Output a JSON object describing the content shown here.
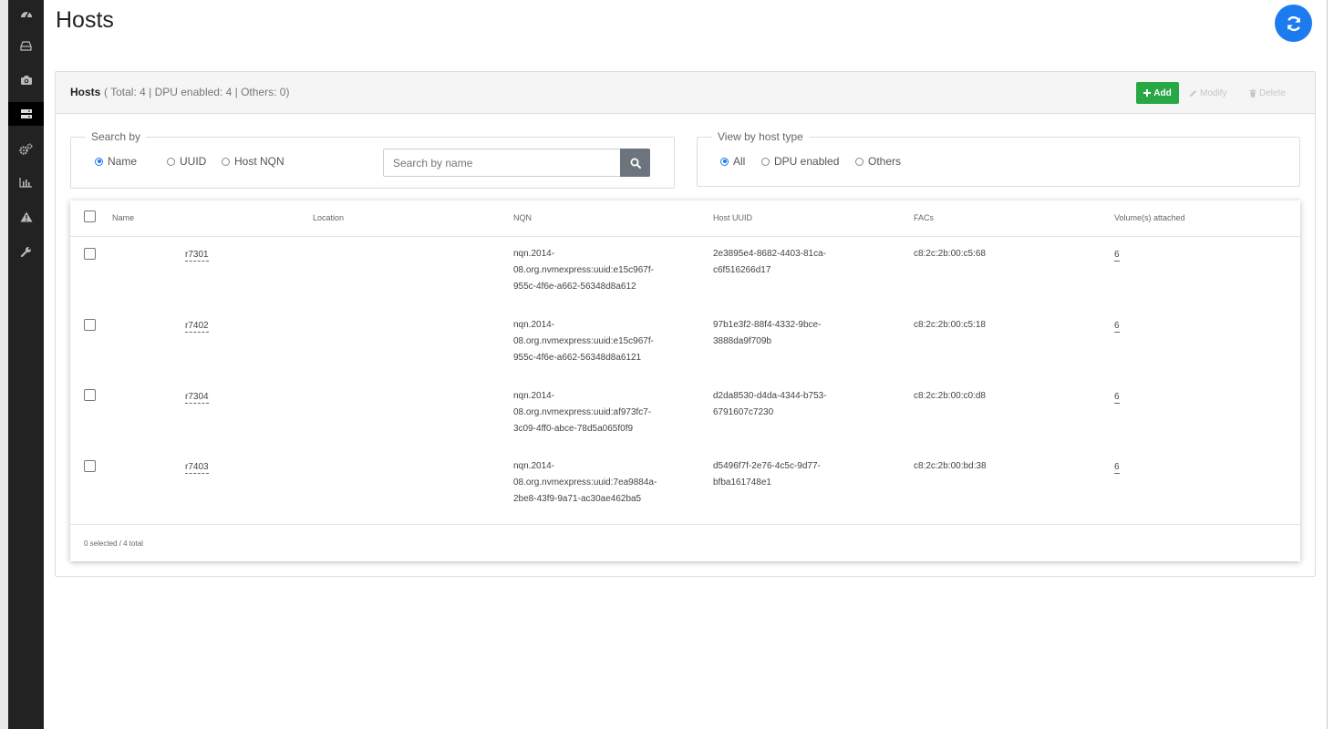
{
  "sidebar": {
    "items": [
      {
        "icon": "dashboard-icon",
        "active": false
      },
      {
        "icon": "drive-icon",
        "active": false
      },
      {
        "icon": "camera-icon",
        "active": false
      },
      {
        "icon": "server-icon",
        "active": true
      },
      {
        "icon": "gears-icon",
        "active": false
      },
      {
        "icon": "bar-chart-icon",
        "active": false
      },
      {
        "icon": "warning-icon",
        "active": false
      },
      {
        "icon": "wrench-icon",
        "active": false
      }
    ]
  },
  "page": {
    "title": "Hosts",
    "refresh_icon": "refresh-icon"
  },
  "panel": {
    "title": "Hosts",
    "summary": "( Total: 4 | DPU enabled: 4 | Others: 0)",
    "add_label": "Add",
    "modify_label": "Modify",
    "delete_label": "Delete"
  },
  "search": {
    "legend": "Search by",
    "options": [
      "Name",
      "UUID",
      "Host NQN"
    ],
    "selected": "Name",
    "placeholder": "Search by name",
    "value": ""
  },
  "filter": {
    "legend": "View by host type",
    "options": [
      "All",
      "DPU enabled",
      "Others"
    ],
    "selected": "All"
  },
  "table": {
    "columns": [
      "Name",
      "Location",
      "NQN",
      "Host UUID",
      "FACs",
      "Volume(s) attached"
    ],
    "rows": [
      {
        "name": "r7301",
        "location": "",
        "nqn": [
          "nqn.2014-",
          "08.org.nvmexpress:uuid:e15c967f-",
          "955c-4f6e-a662-56348d8a612"
        ],
        "uuid": [
          "2e3895e4-8682-4403-81ca-",
          "c6f516266d17"
        ],
        "facs": "c8:2c:2b:00:c5:68",
        "volumes": "6"
      },
      {
        "name": "r7402",
        "location": "",
        "nqn": [
          "nqn.2014-",
          "08.org.nvmexpress:uuid:e15c967f-",
          "955c-4f6e-a662-56348d8a6121"
        ],
        "uuid": [
          "97b1e3f2-88f4-4332-9bce-",
          "3888da9f709b"
        ],
        "facs": "c8:2c:2b:00:c5:18",
        "volumes": "6"
      },
      {
        "name": "r7304",
        "location": "",
        "nqn": [
          "nqn.2014-",
          "08.org.nvmexpress:uuid:af973fc7-",
          "3c09-4ff0-abce-78d5a065f0f9"
        ],
        "uuid": [
          "d2da8530-d4da-4344-b753-",
          "6791607c7230"
        ],
        "facs": "c8:2c:2b:00:c0:d8",
        "volumes": "6"
      },
      {
        "name": "r7403",
        "location": "",
        "nqn": [
          "nqn.2014-",
          "08.org.nvmexpress:uuid:7ea9884a-",
          "2be8-43f9-9a71-ac30ae462ba5"
        ],
        "uuid": [
          "d5496f7f-2e76-4c5c-9d77-",
          "bfba161748e1"
        ],
        "facs": "c8:2c:2b:00:bd:38",
        "volumes": "6"
      }
    ],
    "footer": "0 selected / 4 total"
  },
  "colors": {
    "accent": "#1d7bf0",
    "add_button": "#28a745",
    "sidebar": "#222222"
  }
}
